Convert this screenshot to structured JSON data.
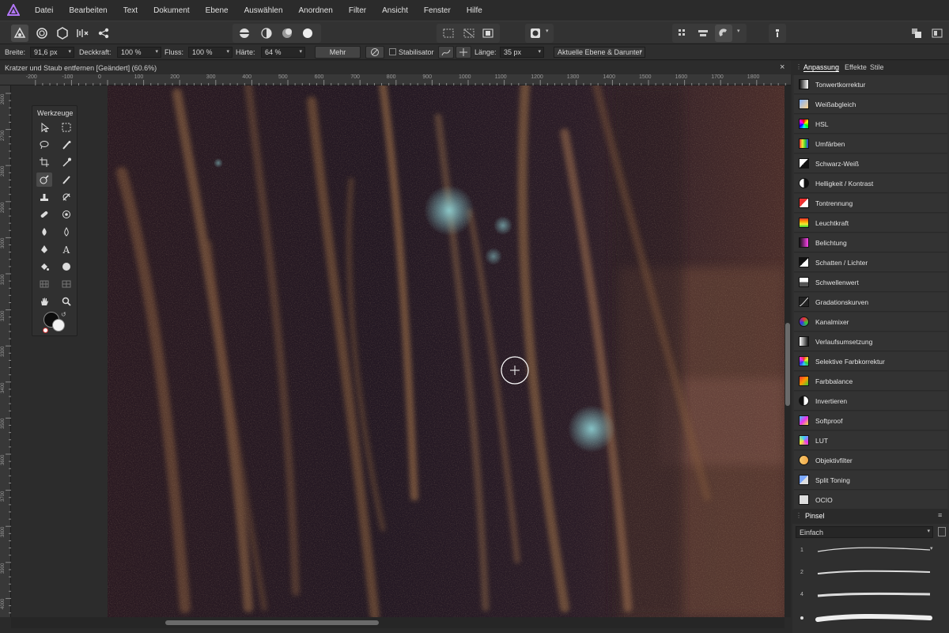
{
  "menu": [
    "Datei",
    "Bearbeiten",
    "Text",
    "Dokument",
    "Ebene",
    "Auswählen",
    "Anordnen",
    "Filter",
    "Ansicht",
    "Fenster",
    "Hilfe"
  ],
  "context": {
    "breite_label": "Breite:",
    "breite_value": "91,6 px",
    "deckkraft_label": "Deckkraft:",
    "deckkraft_value": "100 %",
    "fluss_label": "Fluss:",
    "fluss_value": "100 %",
    "haerte_label": "Härte:",
    "haerte_value": "64 %",
    "mehr_label": "Mehr",
    "stabilisator_label": "Stabilisator",
    "laenge_label": "Länge:",
    "laenge_value": "35 px",
    "source_value": "Aktuelle Ebene & Darunter"
  },
  "document": {
    "title": "Kratzer und Staub entfernen [Geändert] (60.6%)",
    "close": "×"
  },
  "ruler": {
    "h": [
      "-200",
      "-100",
      "0",
      "100",
      "200",
      "300",
      "400",
      "500",
      "600",
      "700",
      "800",
      "900",
      "1000",
      "1100",
      "1200",
      "1300",
      "1400",
      "1500",
      "1600",
      "1700",
      "1800"
    ],
    "v": [
      "2600",
      "2700",
      "2800",
      "2900",
      "3000",
      "3100",
      "3200",
      "3300",
      "3400",
      "3500",
      "3600",
      "3700",
      "3800",
      "3900",
      "4000"
    ]
  },
  "tools_panel": {
    "title": "Werkzeuge"
  },
  "right_panel": {
    "tabs": [
      "Anpassung",
      "Effekte",
      "Stile"
    ],
    "adjustments": [
      "Tonwertkorrektur",
      "Weißabgleich",
      "HSL",
      "Umfärben",
      "Schwarz-Weiß",
      "Helligkeit / Kontrast",
      "Tontrennung",
      "Leuchtkraft",
      "Belichtung",
      "Schatten / Lichter",
      "Schwellenwert",
      "Gradationskurven",
      "Kanalmixer",
      "Verlaufsumsetzung",
      "Selektive Farbkorrektur",
      "Farbbalance",
      "Invertieren",
      "Softproof",
      "LUT",
      "Objektivfilter",
      "Split Toning",
      "OCIO"
    ],
    "brush_tab": "Pinsel",
    "brush_category": "Einfach",
    "brush_sizes": [
      "1",
      "2",
      "4",
      ""
    ]
  },
  "colors": {
    "accent": "#a66cf5",
    "panel": "#2f2f2f",
    "bg": "#2a2a2a"
  }
}
